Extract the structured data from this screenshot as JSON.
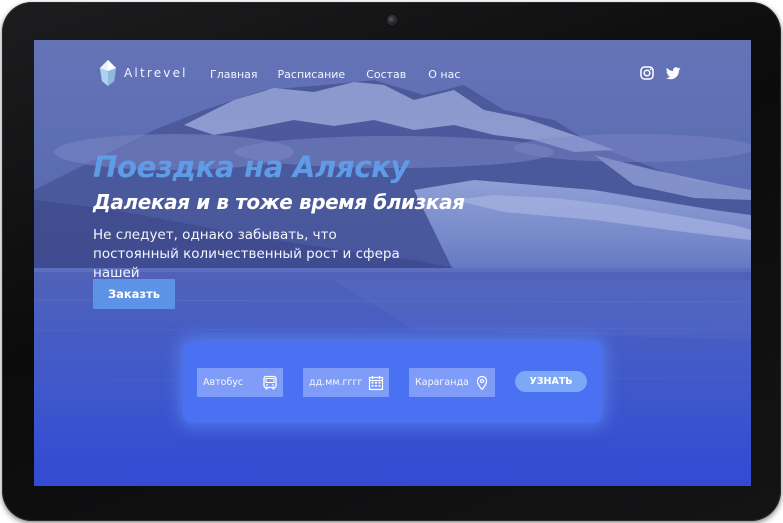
{
  "brand": {
    "name": "Altrevel",
    "logo_icon": "crystal-logo-icon"
  },
  "nav": {
    "items": [
      {
        "label": "Главная"
      },
      {
        "label": "Расписание"
      },
      {
        "label": "Состав"
      },
      {
        "label": "О нас"
      }
    ]
  },
  "social": {
    "icons": [
      "instagram-icon",
      "twitter-icon"
    ]
  },
  "hero": {
    "title": "Поездка на Аляску",
    "subtitle": "Далекая и в тоже время близкая",
    "description": "Не следует, однако забывать, что постоянный количественный рост и сфера нашей",
    "order_label": "Заказть"
  },
  "booking": {
    "transport_value": "Автобус",
    "transport_icon": "bus-icon",
    "date_placeholder": "дд.мм.гггг",
    "date_icon": "calendar-icon",
    "city_value": "Караганда",
    "city_icon": "location-pin-icon",
    "search_label": "УЗНАТЬ"
  },
  "colors": {
    "accent": "#5f9ce8",
    "button": "#5c93e6",
    "panel": "#4a71f2",
    "field": "#7f9df8",
    "search_button": "#7fa7f7"
  }
}
